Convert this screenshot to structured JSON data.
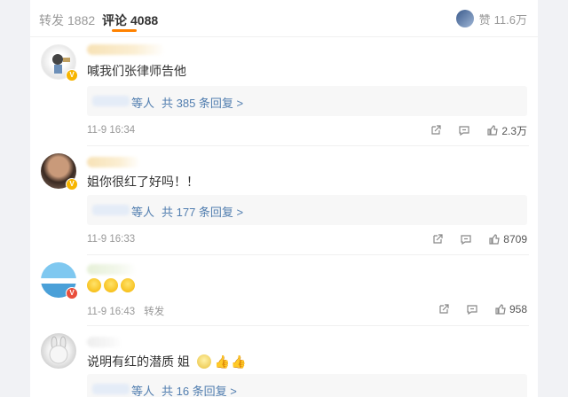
{
  "tabs": {
    "repost": {
      "label": "转发",
      "count": "1882"
    },
    "comments": {
      "label": "评论",
      "count": "4088"
    }
  },
  "likes_summary": {
    "label": "赞",
    "count": "11.6万"
  },
  "icons": {
    "share": "share-icon",
    "comment": "comment-icon",
    "like": "thumbs-up-icon"
  },
  "colors": {
    "accent": "#ff8200",
    "link": "#507daf",
    "vip_badge": "#f7b500",
    "red_badge": "#e94e3c"
  },
  "comments": [
    {
      "text": "喊我们张律师告他",
      "reply_etc": "等人",
      "reply_count": "共 385 条回复 >",
      "time": "11-9 16:34",
      "source": "",
      "likes": "2.3万",
      "badge": "V"
    },
    {
      "text": "姐你很红了好吗！！",
      "reply_etc": "等人",
      "reply_count": "共 177 条回复 >",
      "time": "11-9 16:33",
      "source": "",
      "likes": "8709",
      "badge": "V"
    },
    {
      "text": "",
      "time": "11-9 16:43",
      "source": "转发",
      "likes": "958",
      "badge": "V"
    },
    {
      "text": "说明有红的潜质 姐",
      "reply_etc": "等人",
      "reply_count": "共 16 条回复 >",
      "badge": ""
    }
  ]
}
